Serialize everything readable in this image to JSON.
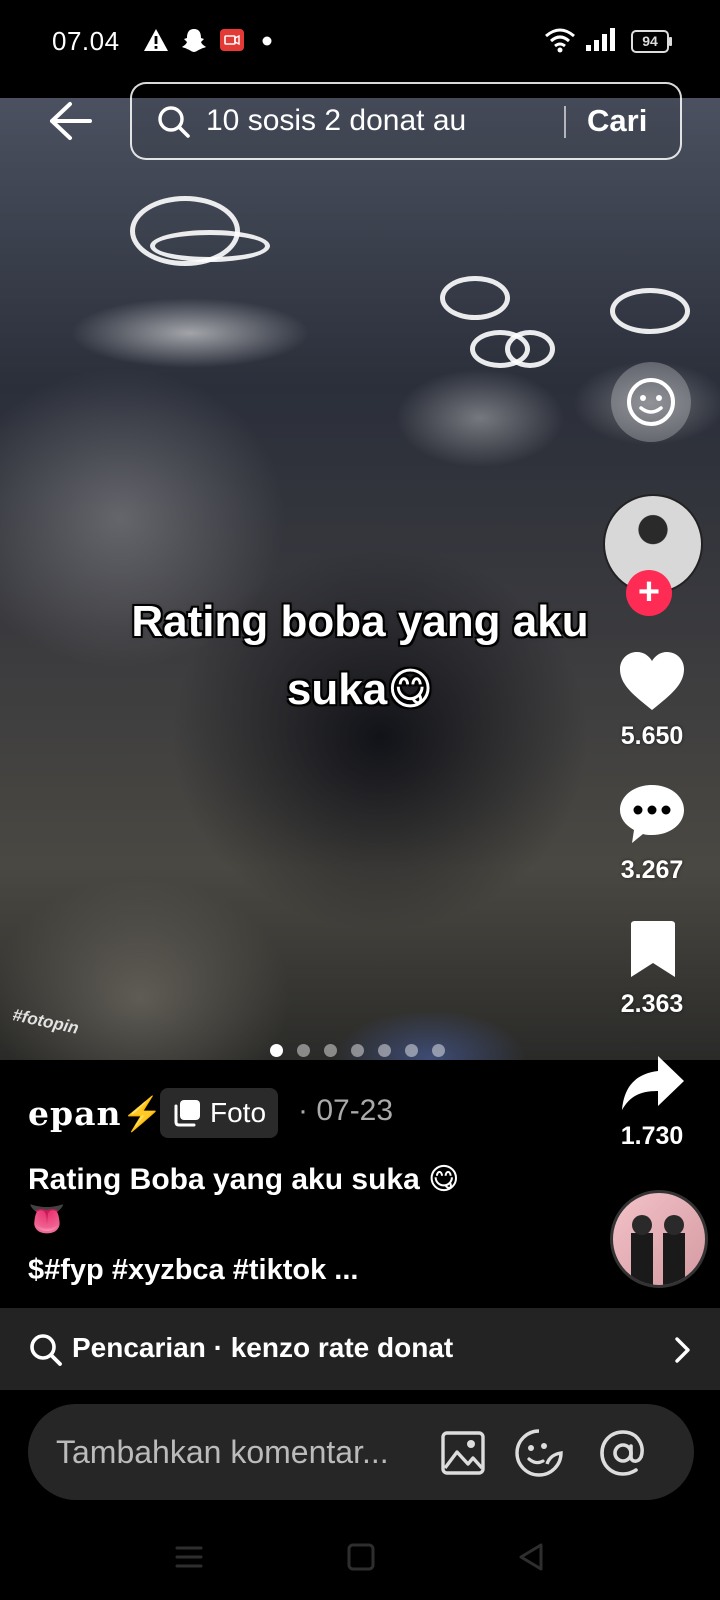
{
  "status_bar": {
    "time": "07.04",
    "battery": "94",
    "icons": [
      "warning-icon",
      "snapchat-icon",
      "screen-record-icon",
      "dot-icon",
      "wifi-icon",
      "signal-icon",
      "battery-icon"
    ]
  },
  "header": {
    "search_query": "10 sosis 2 donat au",
    "search_button": "Cari"
  },
  "post": {
    "caption_overlay_line1": "Rating boba yang aku",
    "caption_overlay_line2": "suka😋",
    "watermark": "#fotopin",
    "carousel_total": 7,
    "carousel_active": 1,
    "username": "epan⚡",
    "type_tag": "Foto",
    "date": "· 07-23",
    "description_line1": "Rating Boba yang aku suka 😋",
    "description_line2": "👅",
    "hashtags": "$#fyp #xyzbca #tiktok ..."
  },
  "actions": {
    "likes": "5.650",
    "comments": "3.267",
    "saves": "2.363",
    "shares": "1.730",
    "follow_symbol": "+"
  },
  "search_suggestion": {
    "text": "Pencarian · kenzo rate donat"
  },
  "comment_bar": {
    "placeholder": "Tambahkan komentar..."
  },
  "colors": {
    "accent": "#fe2c55",
    "background": "#000000",
    "panel": "#232323"
  }
}
